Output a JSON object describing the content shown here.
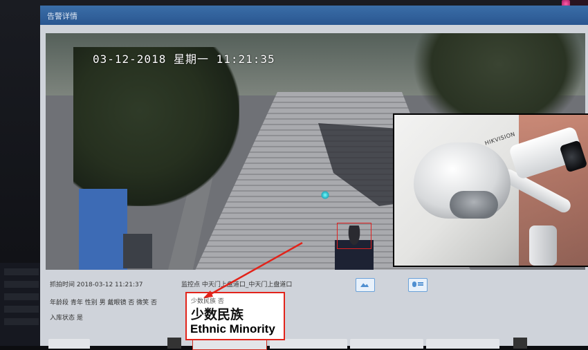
{
  "window": {
    "title": "告警详情"
  },
  "video": {
    "timestamp": "03-12-2018 星期一 11:21:35"
  },
  "inset": {
    "brand": "HIKVISION"
  },
  "details": {
    "capture_time": "抓拍时间 2018-03-12 11:21:37",
    "monitor_point": "监控点 中天门上盘道口_中天门上盘道口",
    "attributes": "年龄段 青年   性别 男   戴眼镜 否   微笑 否",
    "storage_status": "入库状态 是"
  },
  "callout": {
    "small_text": "少数民族 否",
    "label_zh": "少数民族",
    "label_en": "Ethnic Minority"
  },
  "colors": {
    "accent": "#e2231a",
    "titlebar": "#2f5f9a",
    "icon_blue": "#4f8fd1"
  },
  "icons": [
    "image-icon",
    "id-card-icon"
  ]
}
